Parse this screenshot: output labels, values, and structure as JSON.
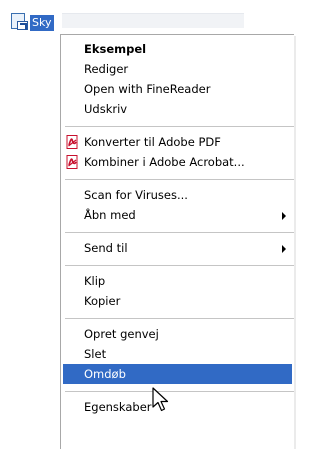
{
  "file": {
    "name": "Sky"
  },
  "menu": {
    "items": [
      {
        "label": "Eksempel"
      },
      {
        "label": "Rediger"
      },
      {
        "label": "Open with FineReader"
      },
      {
        "label": "Udskriv"
      },
      {
        "label": "Konverter til Adobe PDF",
        "icon": "adobe-pdf-icon"
      },
      {
        "label": "Kombiner i Adobe Acrobat...",
        "icon": "adobe-pdf-icon"
      },
      {
        "label": "Scan for Viruses..."
      },
      {
        "label": "Åbn med"
      },
      {
        "label": "Send til"
      },
      {
        "label": "Klip"
      },
      {
        "label": "Kopier"
      },
      {
        "label": "Opret genvej"
      },
      {
        "label": "Slet"
      },
      {
        "label": "Omdøb"
      },
      {
        "label": "Egenskaber"
      }
    ]
  },
  "colors": {
    "highlight": "#316ac5",
    "highlight_text": "#ffffff",
    "pdf_red": "#c8102e"
  },
  "cursor": "arrow-cursor-icon"
}
